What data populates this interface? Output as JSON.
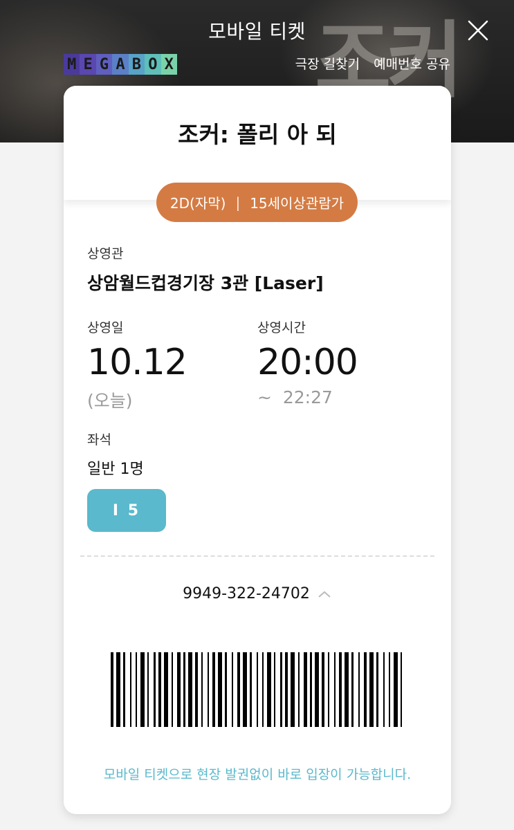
{
  "header": {
    "title": "모바일 티켓",
    "close_icon": "close-icon",
    "logo_letters": [
      "M",
      "E",
      "G",
      "A",
      "B",
      "O",
      "X"
    ],
    "logo_colors": [
      "#4b3a9c",
      "#5a47b0",
      "#5f5fc0",
      "#5b80c8",
      "#58a3c8",
      "#5ec0b9",
      "#7ad3a8"
    ],
    "links": {
      "directions": "극장 길찾기",
      "share": "예매번호 공유"
    },
    "poster_text": "조커"
  },
  "ticket": {
    "movie_title": "조커: 폴리 아 되",
    "format": "2D(자막)",
    "separator": "|",
    "rating": "15세이상관람가",
    "theater_label": "상영관",
    "theater_value": "상암월드컵경기장 3관 [Laser]",
    "date_label": "상영일",
    "date_value": "10.12",
    "date_sub": "(오늘)",
    "time_label": "상영시간",
    "time_value": "20:00",
    "time_sub": "~  22:27",
    "seat_label": "좌석",
    "seat_count": "일반 1명",
    "seat_number": "I 5",
    "booking_number": "9949-322-24702",
    "notice": "모바일 티켓으로 현장 발권없이 바로 입장이 가능합니다."
  },
  "colors": {
    "accent_orange": "#d47b43",
    "accent_teal": "#5ab9cc",
    "background": "#f3f3f3"
  }
}
